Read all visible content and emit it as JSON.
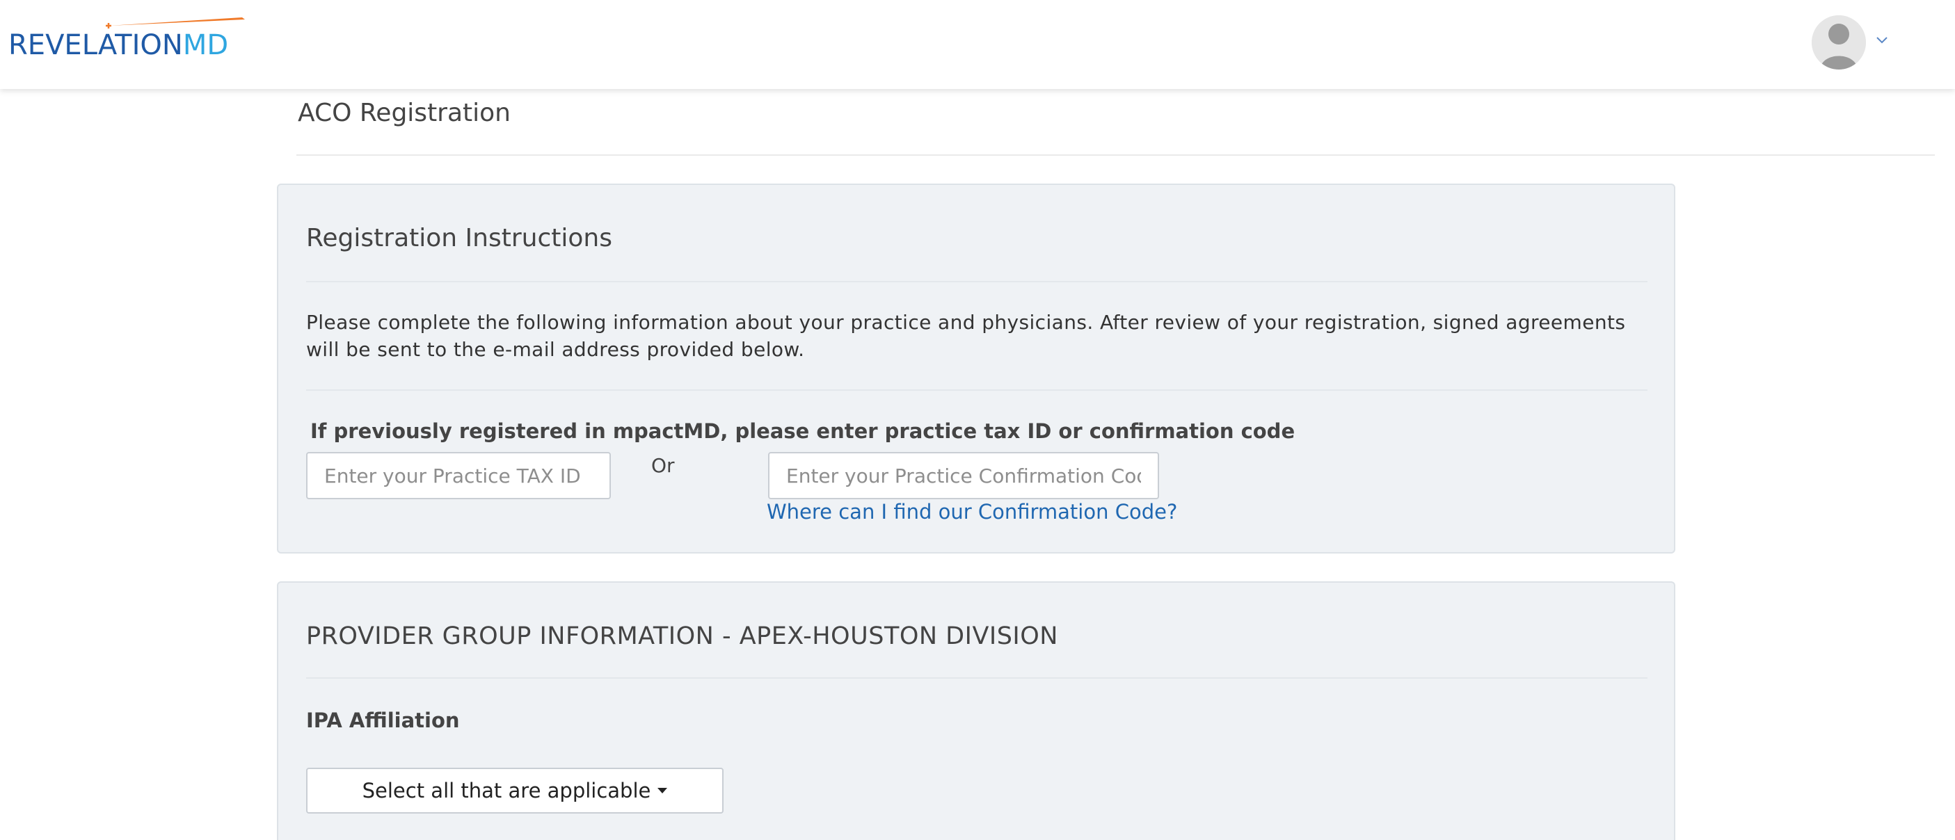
{
  "header": {
    "logo_text_main": "REVELATION",
    "logo_text_accent": "MD",
    "avatar_icon": "user-avatar-icon",
    "menu_icon": "chevron-down-icon"
  },
  "page": {
    "title": "ACO Registration"
  },
  "instructions_panel": {
    "heading": "Registration Instructions",
    "body": "Please complete the following information about your practice and physicians. After review of your registration, signed agreements will be sent to the e-mail address provided below.",
    "lookup_label": "If previously registered in mpactMD, please enter practice tax ID or confirmation code",
    "tax_id_placeholder": "Enter your Practice TAX ID",
    "or_text": "Or",
    "confirmation_placeholder": "Enter your Practice Confirmation Code",
    "help_link": "Where can I find our Confirmation Code?"
  },
  "provider_panel": {
    "heading": "PROVIDER GROUP INFORMATION - APEX-HOUSTON DIVISION",
    "ipa_label": "IPA Affiliation",
    "ipa_select_label": "Select all that are applicable"
  },
  "colors": {
    "logo_primary": "#1f5aa6",
    "logo_accent": "#2fa6e0",
    "logo_swoosh": "#f07a2a",
    "link": "#1f67b1",
    "panel_background": "#eff2f5"
  }
}
